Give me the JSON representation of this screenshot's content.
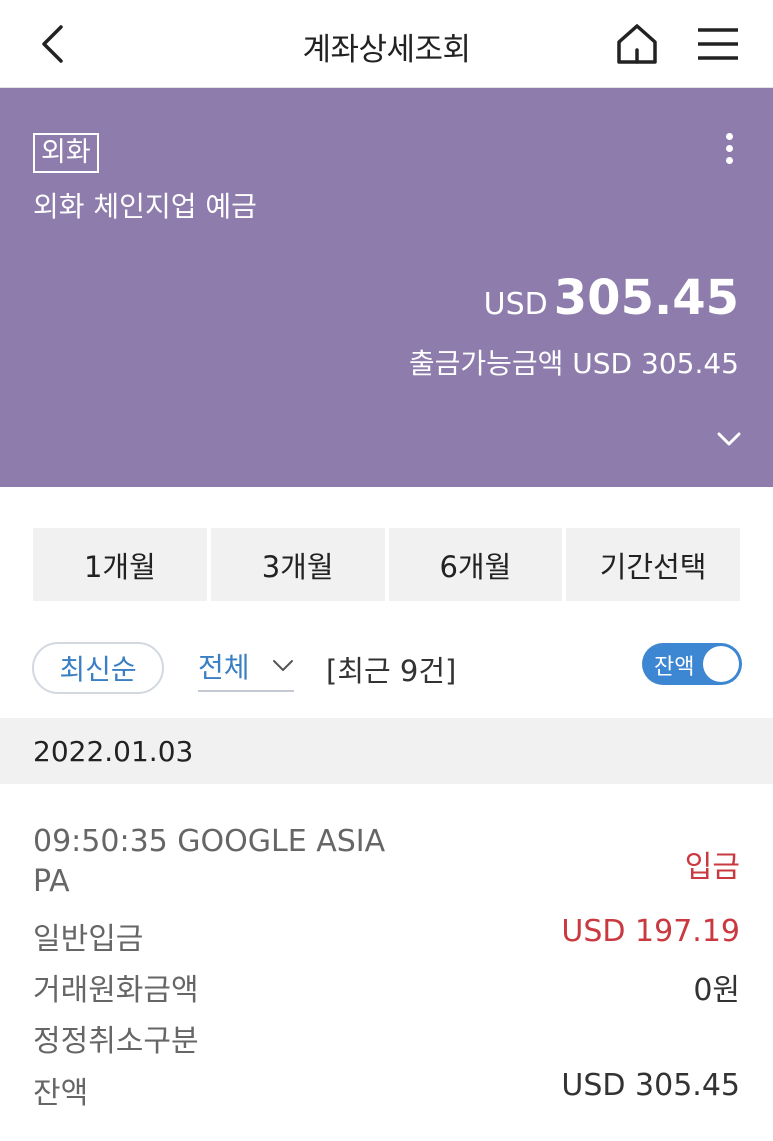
{
  "header": {
    "title": "계좌상세조회",
    "back_icon": "chevron-left-icon",
    "home_icon": "home-icon",
    "menu_icon": "hamburger-menu-icon"
  },
  "account": {
    "badge": "외화",
    "name": "외화 체인지업 예금",
    "balance_currency": "USD",
    "balance_amount": "305.45",
    "available_text": "출금가능금액 USD 305.45",
    "background_color": "#8d7cac"
  },
  "periods": [
    {
      "label": "1개월"
    },
    {
      "label": "3개월"
    },
    {
      "label": "6개월"
    },
    {
      "label": "기간선택"
    }
  ],
  "filters": {
    "sort_label": "최신순",
    "type_label": "전체",
    "count_text": "[최근 9건]",
    "balance_toggle_label": "잔액",
    "balance_toggle_on": true,
    "accent_color": "#3d86d2"
  },
  "transactions": [
    {
      "date": "2022.01.03",
      "description": "09:50:35 GOOGLE ASIA PA",
      "type": "입금",
      "rows": [
        {
          "label": "일반입금",
          "value": "USD 197.19"
        },
        {
          "label": "거래원화금액",
          "value": "0원"
        },
        {
          "label": "정정취소구분",
          "value": ""
        },
        {
          "label": "잔액",
          "value": "USD 305.45"
        }
      ]
    }
  ],
  "colors": {
    "deposit_red": "#c9393f"
  }
}
